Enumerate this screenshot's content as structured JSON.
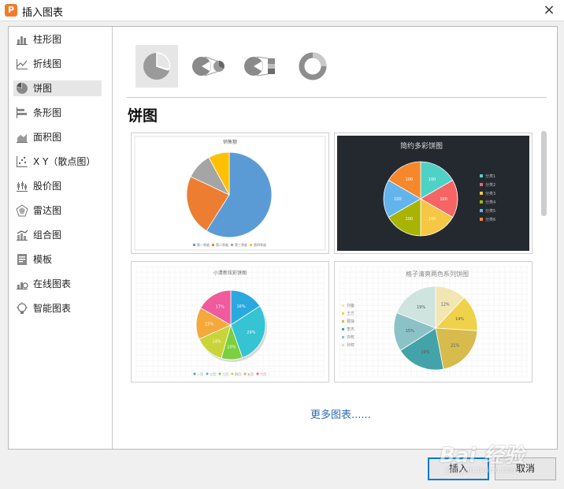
{
  "window": {
    "title": "插入图表",
    "icon_letter": "P",
    "close_label": "×"
  },
  "sidebar": {
    "items": [
      {
        "label": "柱形图",
        "icon": "column-chart-icon"
      },
      {
        "label": "折线图",
        "icon": "line-chart-icon"
      },
      {
        "label": "饼图",
        "icon": "pie-chart-icon",
        "selected": true
      },
      {
        "label": "条形图",
        "icon": "bar-chart-icon"
      },
      {
        "label": "面积图",
        "icon": "area-chart-icon"
      },
      {
        "label": "X Y（散点图）",
        "icon": "scatter-chart-icon"
      },
      {
        "label": "股价图",
        "icon": "stock-chart-icon"
      },
      {
        "label": "雷达图",
        "icon": "radar-chart-icon"
      },
      {
        "label": "组合图",
        "icon": "combo-chart-icon"
      },
      {
        "label": "模板",
        "icon": "template-icon"
      },
      {
        "label": "在线图表",
        "icon": "online-chart-icon"
      },
      {
        "label": "智能图表",
        "icon": "smart-chart-icon"
      }
    ]
  },
  "subtypes": [
    {
      "name": "pie",
      "icon": "pie-subtype-icon",
      "selected": true
    },
    {
      "name": "pie-of-pie",
      "icon": "pie-of-pie-subtype-icon"
    },
    {
      "name": "bar-of-pie",
      "icon": "bar-of-pie-subtype-icon"
    },
    {
      "name": "doughnut",
      "icon": "doughnut-subtype-icon"
    }
  ],
  "section": {
    "title": "饼图"
  },
  "templates": [
    {
      "title": "销售额",
      "legend": [
        "第一季度",
        "第二季度",
        "第三季度",
        "第四季度"
      ],
      "values": [
        59,
        23,
        10,
        8
      ],
      "colors": [
        "#5b9bd5",
        "#ed7d31",
        "#a5a5a5",
        "#ffc000"
      ]
    },
    {
      "title": "简约多彩饼图",
      "legend": [
        "分类1",
        "分类2",
        "分类3",
        "分类4",
        "分类5",
        "分类6"
      ],
      "values": [
        100,
        100,
        100,
        100,
        100,
        100
      ],
      "colors": [
        "#4fd1c5",
        "#f56565",
        "#f6c744",
        "#a8b400",
        "#63b3ed",
        "#f6872b"
      ],
      "background": "#24292f"
    },
    {
      "title": "小清新炫彩饼图",
      "legend": [
        "一月",
        "二月",
        "三月",
        "四月",
        "五月",
        "六月"
      ],
      "labels": [
        "16%",
        "29%",
        "10%",
        "14%",
        "15%",
        "17%"
      ],
      "values": [
        16,
        29,
        10,
        14,
        15,
        17
      ],
      "colors": [
        "#2aa8e0",
        "#36c3d4",
        "#7ccf3f",
        "#c8d43a",
        "#f6a93b",
        "#ef5b9c"
      ]
    },
    {
      "title": "格子清爽两色系列饼图",
      "legend": [
        "刘备",
        "王方",
        "曹操",
        "李杰",
        "许攸",
        "孙权"
      ],
      "labels": [
        "12%",
        "14%",
        "21%",
        "19%",
        "15%",
        "19%"
      ],
      "values": [
        12,
        14,
        21,
        19,
        15,
        19
      ],
      "colors": [
        "#f2e6b3",
        "#efd24a",
        "#d7bb4d",
        "#43a3a8",
        "#8bc2c8",
        "#cfe3df"
      ]
    }
  ],
  "more_link": "更多图表......",
  "buttons": {
    "insert": "插入",
    "cancel": "取消"
  },
  "watermark": {
    "text": "Bai 经验",
    "sub": "jingyan.baidu.com"
  }
}
